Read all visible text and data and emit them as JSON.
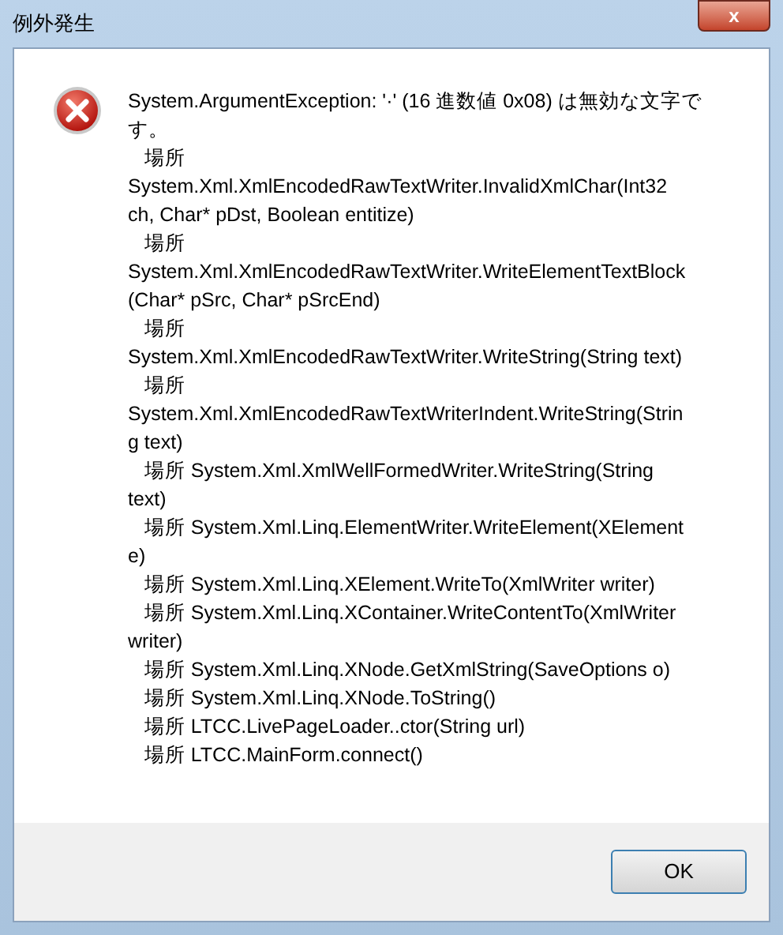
{
  "window": {
    "title": "例外発生",
    "close_glyph": "x"
  },
  "message_lines": [
    "System.ArgumentException: '·' (16 進数値 0x08) は無効な文字で",
    "す。",
    "   場所",
    "System.Xml.XmlEncodedRawTextWriter.InvalidXmlChar(Int32",
    "ch, Char* pDst, Boolean entitize)",
    "   場所",
    "System.Xml.XmlEncodedRawTextWriter.WriteElementTextBlock",
    "(Char* pSrc, Char* pSrcEnd)",
    "   場所",
    "System.Xml.XmlEncodedRawTextWriter.WriteString(String text)",
    "   場所",
    "System.Xml.XmlEncodedRawTextWriterIndent.WriteString(Strin",
    "g text)",
    "   場所 System.Xml.XmlWellFormedWriter.WriteString(String",
    "text)",
    "   場所 System.Xml.Linq.ElementWriter.WriteElement(XElement",
    "e)",
    "   場所 System.Xml.Linq.XElement.WriteTo(XmlWriter writer)",
    "   場所 System.Xml.Linq.XContainer.WriteContentTo(XmlWriter",
    "writer)",
    "   場所 System.Xml.Linq.XNode.GetXmlString(SaveOptions o)",
    "   場所 System.Xml.Linq.XNode.ToString()",
    "   場所 LTCC.LivePageLoader..ctor(String url)",
    "   場所 LTCC.MainForm.connect()"
  ],
  "buttons": [
    "OK"
  ]
}
